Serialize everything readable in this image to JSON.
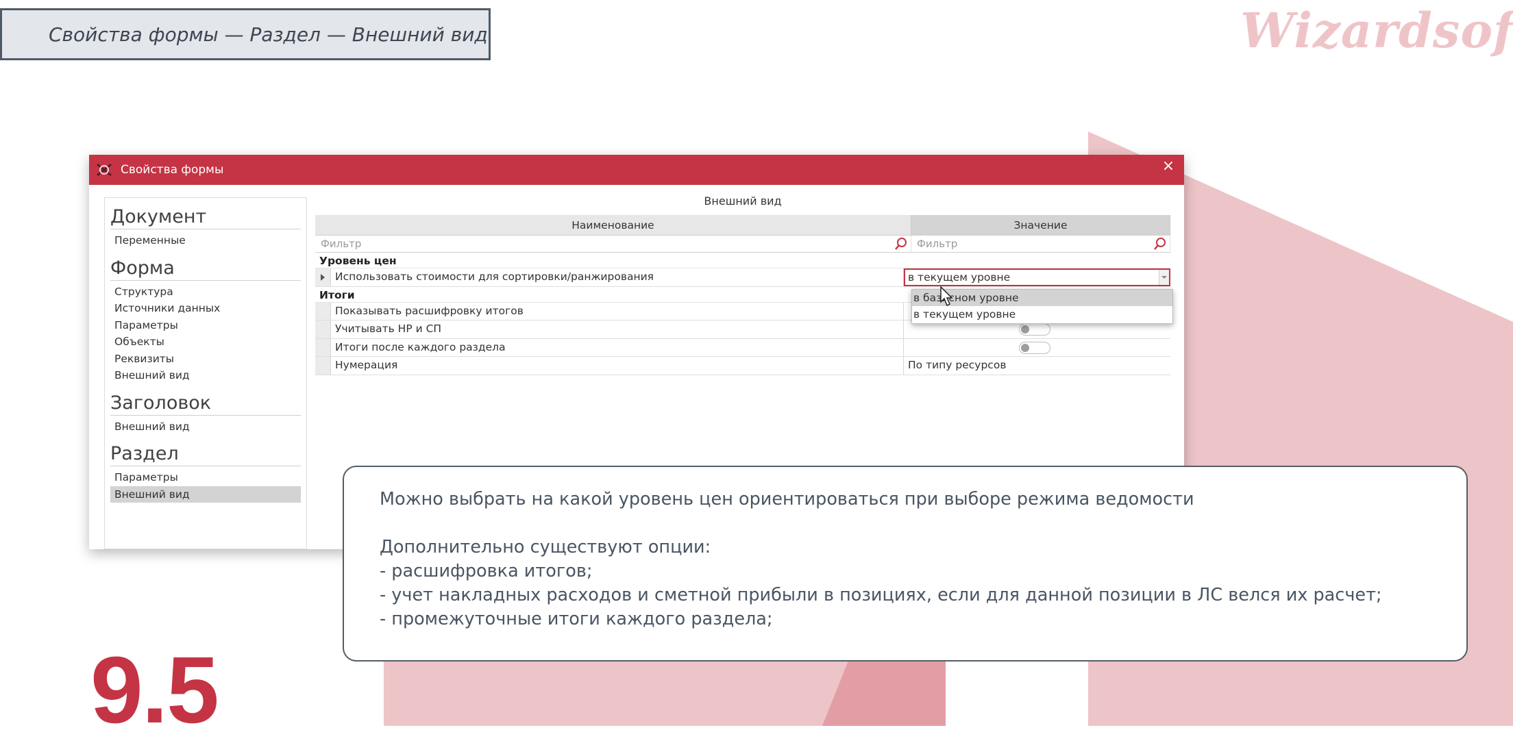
{
  "slide": {
    "header_title": "Свойства формы — Раздел — Внешний вид",
    "logo_text": "Wizardsoft",
    "slide_number": "9.5",
    "accent_color": "#c53444"
  },
  "window": {
    "title": "Свойства формы",
    "close_symbol": "×"
  },
  "sidebar": {
    "groups": [
      {
        "heading": "Документ",
        "items": [
          "Переменные"
        ]
      },
      {
        "heading": "Форма",
        "items": [
          "Структура",
          "Источники данных",
          "Параметры",
          "Объекты",
          "Реквизиты",
          "Внешний вид"
        ]
      },
      {
        "heading": "Заголовок",
        "items": [
          "Внешний вид"
        ]
      },
      {
        "heading": "Раздел",
        "items": [
          "Параметры",
          "Внешний вид"
        ]
      }
    ],
    "selected": "Раздел / Внешний вид"
  },
  "properties": {
    "section_title": "Внешний вид",
    "columns": [
      "Наименование",
      "Значение"
    ],
    "filter_placeholder_name": "Фильтр",
    "filter_placeholder_value": "Фильтр",
    "groups": [
      {
        "name": "Уровень цен",
        "rows": [
          {
            "name": "Использовать стоимости для сортировки/ранжирования",
            "value": "в текущем уровне"
          }
        ]
      },
      {
        "name": "Итоги",
        "rows": [
          {
            "name": "Показывать расшифровку итогов",
            "value": ""
          },
          {
            "name": "Учитывать НР и СП",
            "value": ""
          },
          {
            "name": "Итоги после каждого раздела",
            "value": ""
          },
          {
            "name": "Нумерация",
            "value": "По типу ресурсов"
          }
        ]
      }
    ],
    "dropdown_options": [
      "в базисном уровне",
      "в текущем уровне"
    ],
    "dropdown_hover": "в базисном уровне"
  },
  "callout": {
    "line1": "Можно выбрать на какой уровень цен ориентироваться при выборе режима ведомости",
    "line2": "Дополнительно существуют опции:",
    "line3": "- расшифровка итогов;",
    "line4": "- учет накладных расходов и сметной прибыли в позициях, если для данной позиции в ЛС велся их расчет;",
    "line5": "- промежуточные итоги каждого раздела;"
  }
}
